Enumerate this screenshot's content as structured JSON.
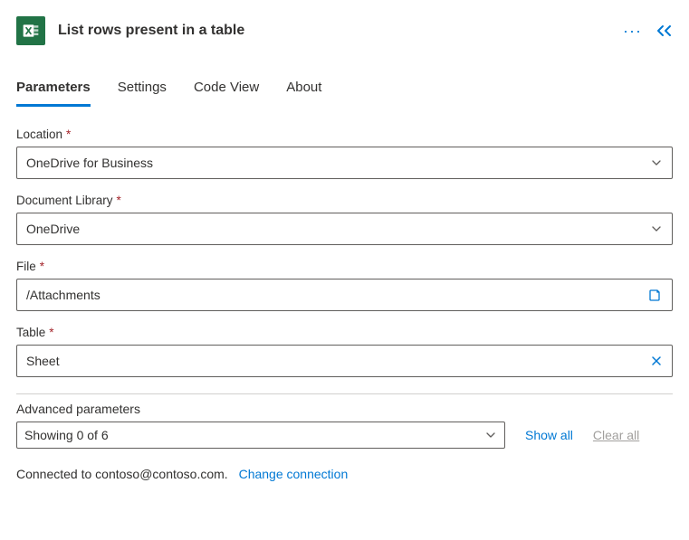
{
  "header": {
    "title": "List rows present in a table"
  },
  "tabs": [
    {
      "label": "Parameters",
      "active": true
    },
    {
      "label": "Settings",
      "active": false
    },
    {
      "label": "Code View",
      "active": false
    },
    {
      "label": "About",
      "active": false
    }
  ],
  "fields": {
    "location": {
      "label": "Location",
      "required": true,
      "value": "OneDrive for Business"
    },
    "library": {
      "label": "Document Library",
      "required": true,
      "value": "OneDrive"
    },
    "file": {
      "label": "File",
      "required": true,
      "value": "/Attachments"
    },
    "table": {
      "label": "Table",
      "required": true,
      "value": "Sheet"
    }
  },
  "advanced": {
    "label": "Advanced parameters",
    "summary": "Showing 0 of 6",
    "show_all": "Show all",
    "clear_all": "Clear all"
  },
  "footer": {
    "connected_prefix": "Connected to ",
    "account": "contoso@contoso.com.",
    "change": "Change connection"
  }
}
